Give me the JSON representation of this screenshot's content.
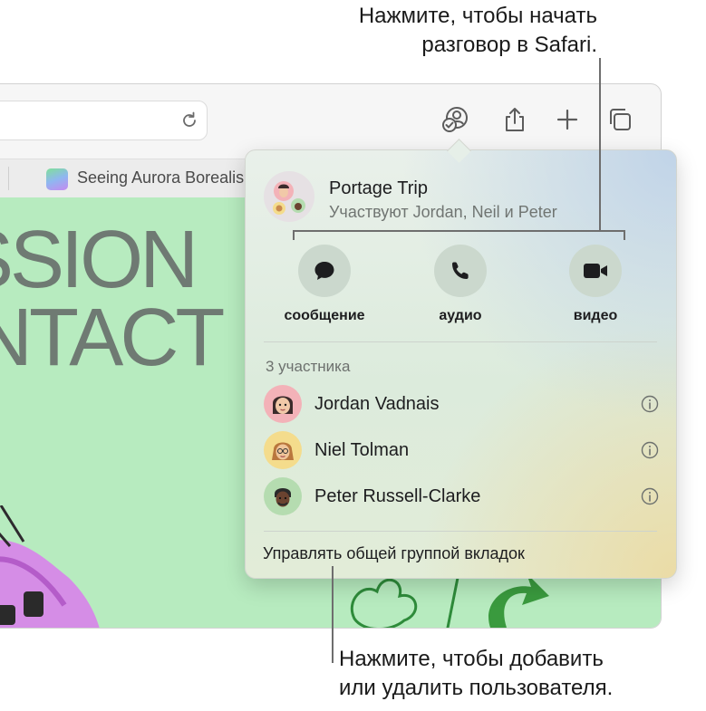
{
  "callouts": {
    "top_line1": "Нажмите, чтобы начать",
    "top_line2": "разговор в Safari.",
    "bottom_line1": "Нажмите, чтобы добавить",
    "bottom_line2": "или удалить пользователя."
  },
  "browser": {
    "tab_title": "Seeing Aurora Borealis",
    "page_headline_1": "SSION",
    "page_headline_2": "NTACT",
    "toolbar_icons": [
      "reload-icon",
      "shareplay-icon",
      "share-icon",
      "new-tab-icon",
      "tab-overview-icon"
    ]
  },
  "popover": {
    "group_name": "Portage Trip",
    "members_summary": "Участвуют Jordan, Neil и Peter",
    "actions": [
      {
        "label": "сообщение",
        "icon": "message-bubble-icon"
      },
      {
        "label": "аудио",
        "icon": "phone-icon"
      },
      {
        "label": "видео",
        "icon": "video-camera-icon"
      }
    ],
    "participants_heading": "3 участника",
    "participants": [
      {
        "name": "Jordan Vadnais",
        "avatar_color": "#f3b2b8"
      },
      {
        "name": "Niel Tolman",
        "avatar_color": "#f4dc8c"
      },
      {
        "name": "Peter Russell-Clarke",
        "avatar_color": "#b5dcb0"
      }
    ],
    "manage_link": "Управлять общей группой вкладок"
  },
  "colors": {
    "page_background": "#b7ebbf",
    "action_circle": "#cbd8cd",
    "annotation_line": "#6e6e6e"
  }
}
